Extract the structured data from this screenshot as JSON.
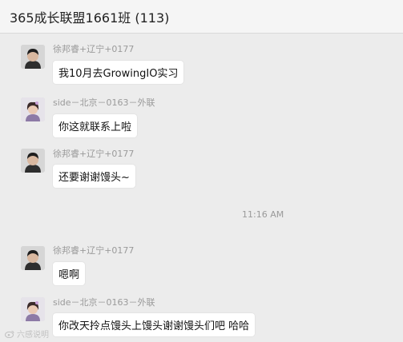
{
  "header": {
    "title": "365成长联盟1661班 (113)"
  },
  "messages": [
    {
      "sender": "徐邦睿+辽宁+0177",
      "text": "我10月去GrowingIO实习",
      "avatar": "boy-avatar"
    },
    {
      "sender": "side－北京－0163－外联",
      "text": "你这就联系上啦",
      "avatar": "girl-avatar"
    },
    {
      "sender": "徐邦睿+辽宁+0177",
      "text": "还要谢谢馒头~",
      "avatar": "boy-avatar"
    },
    {
      "sender": "徐邦睿+辽宁+0177",
      "text": "嗯啊",
      "avatar": "boy-avatar"
    },
    {
      "sender": "side－北京－0163－外联",
      "text": "你改天拎点馒头上馒头谢谢馒头们吧  哈哈",
      "avatar": "girl-avatar"
    }
  ],
  "timestamp": "11:16 AM",
  "watermark": "六感说明",
  "colors": {
    "background": "#ececec",
    "bubble": "#ffffff",
    "meta_text": "#9a9a9a"
  }
}
